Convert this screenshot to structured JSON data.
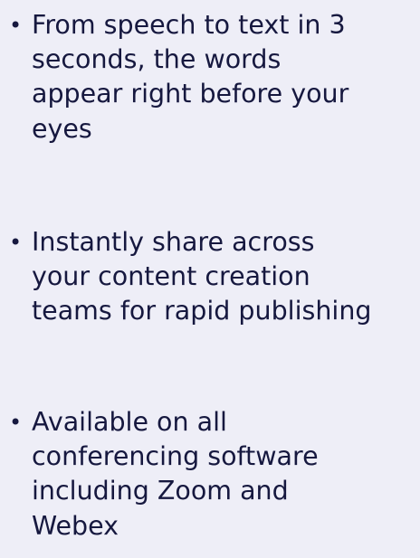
{
  "features": [
    {
      "bullet": "•",
      "text": "From speech to text in 3\nseconds, the words\nappear right before your\neyes"
    },
    {
      "bullet": "•",
      "text": "Instantly share across\nyour content creation\nteams for rapid publishing"
    },
    {
      "bullet": "•",
      "text": "Available on all\nconferencing software\nincluding Zoom and\nWebex"
    }
  ],
  "colors": {
    "background": "#eeeef7",
    "text": "#16183f"
  }
}
